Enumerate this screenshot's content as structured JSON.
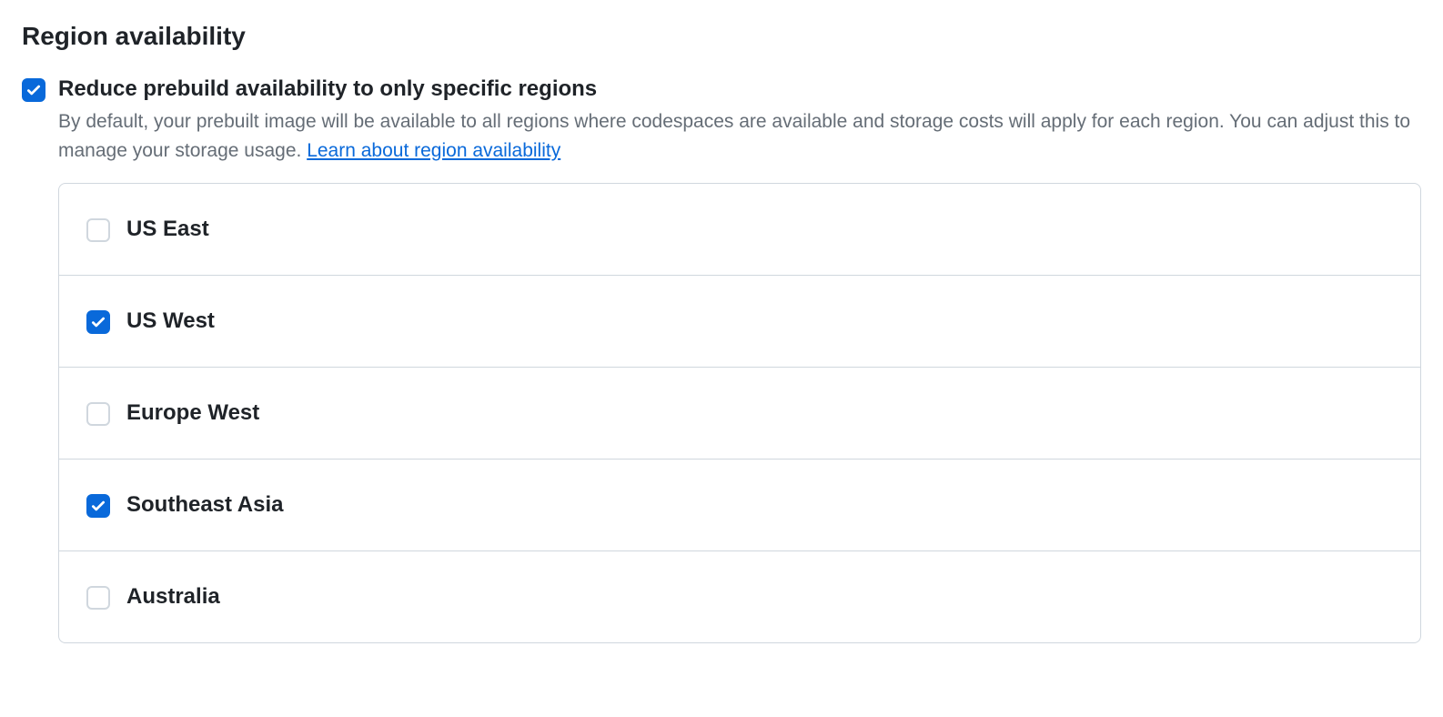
{
  "section": {
    "title": "Region availability"
  },
  "reduce_option": {
    "checked": true,
    "label": "Reduce prebuild availability to only specific regions",
    "description_prefix": "By default, your prebuilt image will be available to all regions where codespaces are available and storage costs will apply for each region. You can adjust this to manage your storage usage. ",
    "link_text": "Learn about region availability"
  },
  "regions": [
    {
      "label": "US East",
      "checked": false
    },
    {
      "label": "US West",
      "checked": true
    },
    {
      "label": "Europe West",
      "checked": false
    },
    {
      "label": "Southeast Asia",
      "checked": true
    },
    {
      "label": "Australia",
      "checked": false
    }
  ]
}
